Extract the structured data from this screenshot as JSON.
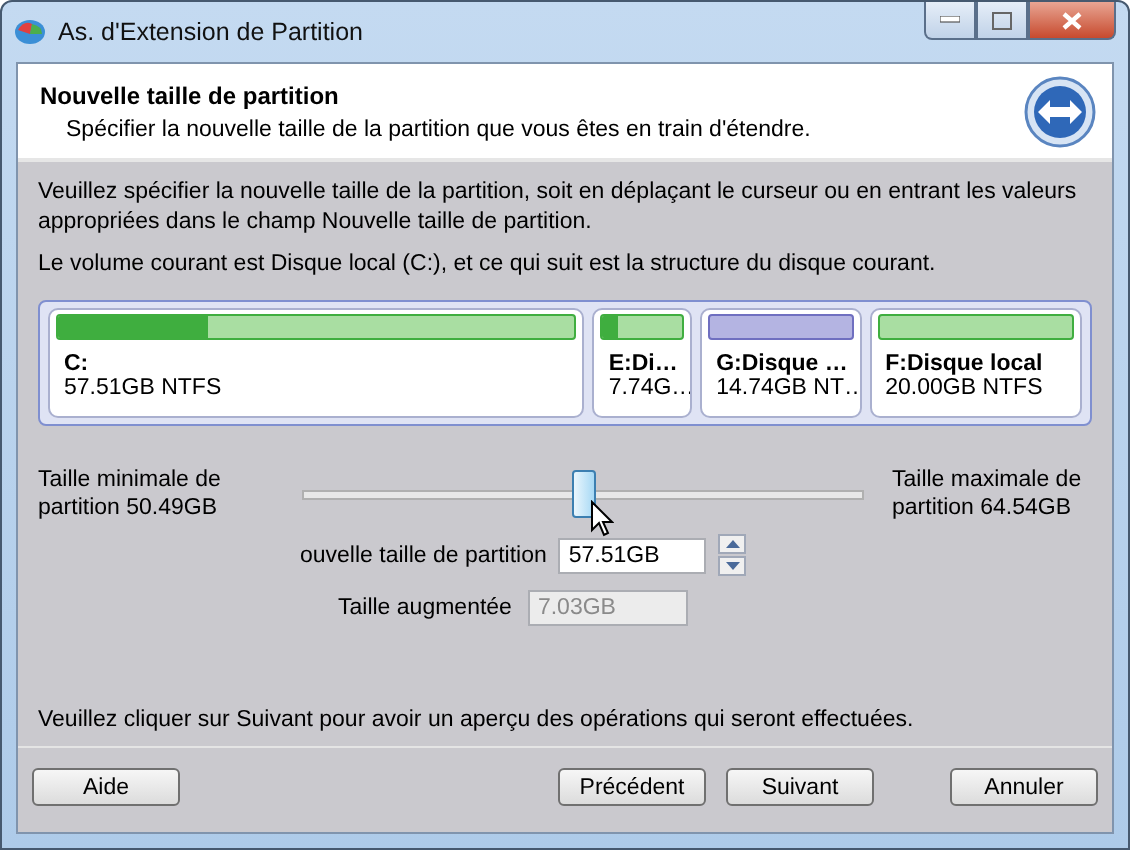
{
  "window": {
    "title": "As. d'Extension de Partition"
  },
  "header": {
    "title": "Nouvelle taille de partition",
    "subtitle": "Spécifier la nouvelle taille de la partition que vous êtes en train d'étendre."
  },
  "instructions": [
    "Veuillez spécifier la nouvelle taille de la partition, soit en déplaçant le curseur ou en entrant les valeurs appropriées dans le champ Nouvelle taille de partition.",
    "Le volume courant est Disque local (C:), et ce qui suit est la structure du disque courant."
  ],
  "partitions": [
    {
      "name": "C:",
      "info": "57.51GB NTFS",
      "level": 0.29,
      "color": "#3fae3f"
    },
    {
      "name": "E:Di…",
      "info": "7.74G…",
      "level": 0.2,
      "color": "#3fae3f"
    },
    {
      "name": "G:Disque …",
      "info": "14.74GB NT…",
      "level": 0,
      "color": "#6f6fc0"
    },
    {
      "name": "F:Disque local",
      "info": "20.00GB NTFS",
      "level": 0,
      "color": "#3fae3f"
    }
  ],
  "slider": {
    "min_label": "Taille minimale de partition 50.49GB",
    "max_label": "Taille maximale de partition 64.54GB",
    "level": 0.5
  },
  "new_size": {
    "label": "ouvelle taille de partition",
    "value": "57.51GB"
  },
  "increase": {
    "label": "Taille augmentée",
    "value": "7.03GB",
    "disabled": true
  },
  "footer_note": "Veuillez cliquer sur Suivant pour avoir un aperçu des opérations qui seront effectuées.",
  "buttons": [
    "Aide",
    "Précédent",
    "Suivant",
    "Annuler"
  ]
}
